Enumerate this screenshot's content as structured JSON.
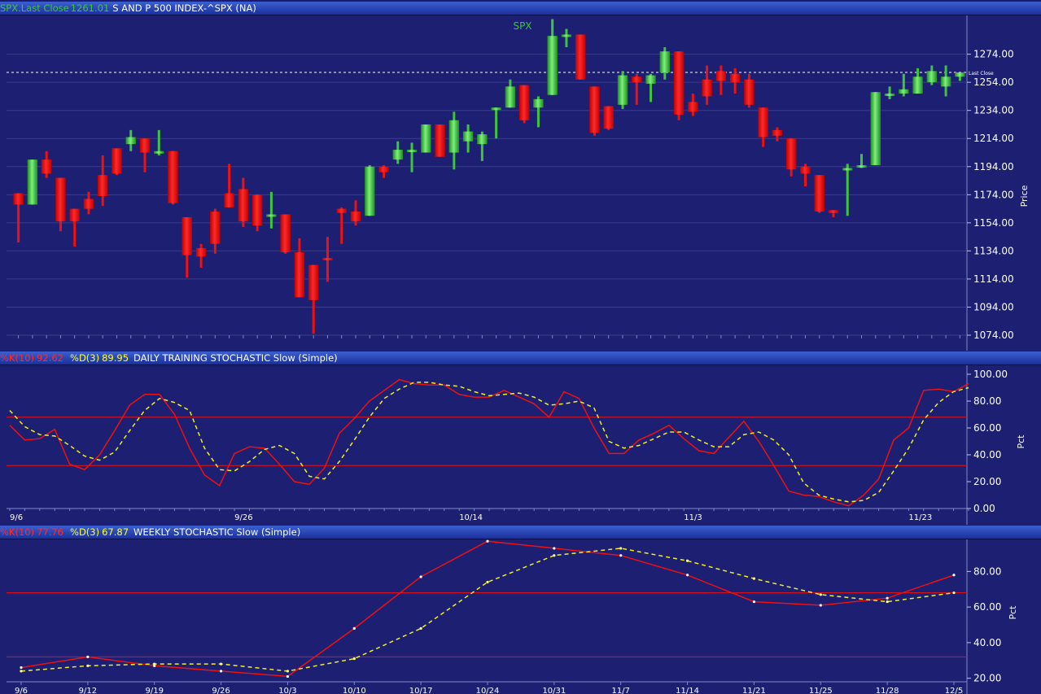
{
  "header_price": {
    "label_a": "SPX.Last Close",
    "value_a": "1261.01",
    "title": "S AND P 500 INDEX-^SPX (NA)"
  },
  "header_daily": {
    "k_label": "%K(10)",
    "k_value": "92.62",
    "d_label": "%D(3)",
    "d_value": "89.95",
    "title": "DAILY TRAINING STOCHASTIC Slow (Simple)"
  },
  "header_weekly": {
    "k_label": "%K(10)",
    "k_value": "77.76",
    "d_label": "%D(3)",
    "d_value": "67.87",
    "title": "WEEKLY STOCHASTIC Slow (Simple)"
  },
  "colors": {
    "up": "#3ec43e",
    "down": "#ee1111",
    "k_line": "#ee1111",
    "d_line": "#f0f020",
    "text": "#ffffff",
    "grid": "#3a3f8a"
  },
  "chart_data": [
    {
      "type": "candlestick",
      "title": "SPX",
      "ylabel": "Price",
      "ylim": [
        1074,
        1290
      ],
      "yticks": [
        "1274.00",
        "1254.00",
        "1234.00",
        "1214.00",
        "1194.00",
        "1174.00",
        "1154.00",
        "1134.00",
        "1114.00",
        "1094.00",
        "1074.00"
      ],
      "last_close_label": "Last Close",
      "last_close": 1261.01,
      "candles": [
        [
          1175,
          1175,
          1140,
          1167
        ],
        [
          1167,
          1199,
          1167,
          1199
        ],
        [
          1199,
          1205,
          1186,
          1189
        ],
        [
          1186,
          1186,
          1148,
          1155
        ],
        [
          1164,
          1164,
          1137,
          1155
        ],
        [
          1171,
          1176,
          1160,
          1164
        ],
        [
          1188,
          1202,
          1166,
          1173
        ],
        [
          1207,
          1207,
          1188,
          1189
        ],
        [
          1210,
          1220,
          1205,
          1215
        ],
        [
          1214,
          1214,
          1190,
          1204
        ],
        [
          1204,
          1220,
          1202,
          1205
        ],
        [
          1205,
          1205,
          1167,
          1168
        ],
        [
          1158,
          1158,
          1115,
          1131
        ],
        [
          1136,
          1139,
          1122,
          1130
        ],
        [
          1162,
          1164,
          1132,
          1139
        ],
        [
          1175,
          1196,
          1165,
          1165
        ],
        [
          1178,
          1186,
          1151,
          1155
        ],
        [
          1174,
          1174,
          1148,
          1152
        ],
        [
          1160,
          1176,
          1150,
          1160
        ],
        [
          1160,
          1160,
          1132,
          1133
        ],
        [
          1133,
          1143,
          1101,
          1101
        ],
        [
          1124,
          1124,
          1075,
          1099
        ],
        [
          1129,
          1144,
          1112,
          1128
        ],
        [
          1164,
          1165,
          1139,
          1161
        ],
        [
          1162,
          1170,
          1152,
          1155
        ],
        [
          1159,
          1195,
          1159,
          1194
        ],
        [
          1194,
          1195,
          1186,
          1190
        ],
        [
          1199,
          1212,
          1196,
          1206
        ],
        [
          1206,
          1211,
          1190,
          1206
        ],
        [
          1204,
          1224,
          1204,
          1224
        ],
        [
          1224,
          1224,
          1201,
          1201
        ],
        [
          1204,
          1233,
          1192,
          1227
        ],
        [
          1212,
          1224,
          1204,
          1219
        ],
        [
          1210,
          1219,
          1198,
          1217
        ],
        [
          1236,
          1236,
          1214,
          1236
        ],
        [
          1236,
          1256,
          1236,
          1251
        ],
        [
          1252,
          1252,
          1225,
          1227
        ],
        [
          1236,
          1244,
          1222,
          1242
        ],
        [
          1245,
          1299,
          1245,
          1287
        ],
        [
          1287,
          1292,
          1279,
          1288
        ],
        [
          1288,
          1288,
          1256,
          1256
        ],
        [
          1251,
          1251,
          1216,
          1218
        ],
        [
          1237,
          1237,
          1220,
          1221
        ],
        [
          1238,
          1262,
          1235,
          1259
        ],
        [
          1258,
          1260,
          1238,
          1254
        ],
        [
          1253,
          1260,
          1240,
          1259
        ],
        [
          1261,
          1279,
          1256,
          1276
        ],
        [
          1276,
          1276,
          1227,
          1231
        ],
        [
          1240,
          1246,
          1230,
          1233
        ],
        [
          1256,
          1266,
          1238,
          1244
        ],
        [
          1262,
          1266,
          1245,
          1255
        ],
        [
          1260,
          1264,
          1246,
          1254
        ],
        [
          1256,
          1260,
          1236,
          1238
        ],
        [
          1236,
          1236,
          1208,
          1215
        ],
        [
          1220,
          1222,
          1212,
          1216
        ],
        [
          1214,
          1214,
          1187,
          1192
        ],
        [
          1194,
          1196,
          1180,
          1189
        ],
        [
          1188,
          1188,
          1161,
          1162
        ],
        [
          1163,
          1163,
          1158,
          1161
        ],
        [
          1193,
          1196,
          1159,
          1193
        ],
        [
          1195,
          1203,
          1193,
          1195
        ],
        [
          1195,
          1247,
          1195,
          1247
        ],
        [
          1245,
          1251,
          1242,
          1246
        ],
        [
          1246,
          1260,
          1244,
          1249
        ],
        [
          1246,
          1264,
          1246,
          1258
        ],
        [
          1254,
          1266,
          1252,
          1262
        ],
        [
          1251,
          1266,
          1244,
          1258
        ],
        [
          1258,
          1260,
          1255,
          1261
        ]
      ]
    },
    {
      "type": "line",
      "title": "DAILY TRAINING STOCHASTIC Slow (Simple)",
      "ylabel": "Pct",
      "ylim": [
        0,
        100
      ],
      "yticks": [
        "100.00",
        "80.00",
        "60.00",
        "40.00",
        "20.00",
        "0.00"
      ],
      "ref_lines": [
        68,
        32
      ],
      "xticks": [
        {
          "i": 0,
          "label": "9/6"
        },
        {
          "i": 15,
          "label": "9/26"
        },
        {
          "i": 30,
          "label": "10/14"
        },
        {
          "i": 45,
          "label": "11/3"
        },
        {
          "i": 60,
          "label": "11/23"
        }
      ],
      "n": 70,
      "series": [
        {
          "key": "k",
          "values": [
            62,
            51,
            52,
            59,
            33,
            29,
            40,
            58,
            77,
            85,
            85,
            70,
            45,
            25,
            17,
            41,
            46,
            45,
            33,
            20,
            18,
            30,
            56,
            67,
            80,
            88,
            96,
            93,
            92,
            92,
            85,
            83,
            83,
            88,
            83,
            78,
            68,
            87,
            82,
            60,
            41,
            41,
            51,
            56,
            62,
            52,
            43,
            41,
            53,
            65,
            50,
            32,
            13,
            10,
            9,
            5,
            2,
            10,
            22,
            51,
            60,
            88,
            89,
            87,
            93
          ]
        },
        {
          "key": "d",
          "values": [
            73,
            61,
            55,
            54,
            47,
            39,
            36,
            42,
            58,
            73,
            82,
            79,
            73,
            45,
            29,
            28,
            35,
            44,
            47,
            41,
            24,
            22,
            35,
            51,
            68,
            82,
            89,
            94,
            94,
            92,
            91,
            87,
            84,
            85,
            86,
            83,
            77,
            78,
            80,
            75,
            50,
            45,
            47,
            52,
            57,
            57,
            51,
            46,
            46,
            55,
            57,
            51,
            40,
            19,
            10,
            7,
            5,
            6,
            12,
            28,
            45,
            66,
            79,
            87,
            90
          ]
        }
      ]
    },
    {
      "type": "line",
      "title": "WEEKLY STOCHASTIC Slow (Simple)",
      "ylabel": "Pct",
      "ylim": [
        18,
        98
      ],
      "yticks": [
        "80.00",
        "60.00",
        "40.00",
        "20.00"
      ],
      "ref_lines": [
        68,
        32
      ],
      "xticks": [
        "9/6",
        "9/12",
        "9/19",
        "9/26",
        "10/3",
        "10/10",
        "10/17",
        "10/24",
        "10/31",
        "11/7",
        "11/14",
        "11/21",
        "11/25",
        "11/28",
        "12/5"
      ],
      "series": [
        {
          "key": "k",
          "values": [
            26,
            32,
            27,
            24,
            21,
            48,
            77,
            97,
            93,
            89,
            78,
            63,
            61,
            65,
            78
          ]
        },
        {
          "key": "d",
          "values": [
            24,
            27,
            28,
            28,
            24,
            31,
            48,
            74,
            89,
            93,
            86,
            76,
            67,
            63,
            68
          ]
        }
      ]
    }
  ]
}
